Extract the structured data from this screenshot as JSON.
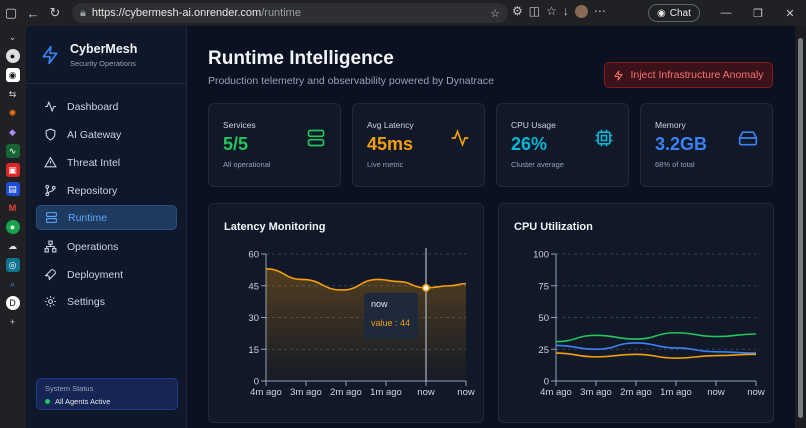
{
  "browser": {
    "url_host": "https://cybermesh-ai.onrender.com",
    "url_path": "/runtime",
    "chat_label": "Chat"
  },
  "sidebar": {
    "brand_name": "CyberMesh",
    "brand_sub": "Security Operations",
    "items": [
      {
        "label": "Dashboard",
        "icon": "activity-icon"
      },
      {
        "label": "AI Gateway",
        "icon": "shield-icon"
      },
      {
        "label": "Threat Intel",
        "icon": "alert-triangle-icon"
      },
      {
        "label": "Repository",
        "icon": "git-branch-icon"
      },
      {
        "label": "Runtime",
        "icon": "server-icon"
      },
      {
        "label": "Operations",
        "icon": "network-icon"
      },
      {
        "label": "Deployment",
        "icon": "rocket-icon"
      },
      {
        "label": "Settings",
        "icon": "gear-icon"
      }
    ],
    "active": "Runtime",
    "status_title": "System Status",
    "status_value": "All Agents Active"
  },
  "header": {
    "title": "Runtime Intelligence",
    "subtitle": "Production telemetry and observability powered by Dynatrace",
    "anomaly_button": "Inject Infrastructure Anomaly"
  },
  "stats": [
    {
      "label": "Services",
      "value": "5/5",
      "sub": "All operational",
      "color": "#22c55e"
    },
    {
      "label": "Avg Latency",
      "value": "45ms",
      "sub": "Live metric",
      "color": "#f59e0b"
    },
    {
      "label": "CPU Usage",
      "value": "26%",
      "sub": "Cluster average",
      "color": "#06b6d4"
    },
    {
      "label": "Memory",
      "value": "3.2GB",
      "sub": "68% of total",
      "color": "#3b82f6"
    }
  ],
  "latency_chart": {
    "title": "Latency Monitoring",
    "tooltip_label": "now",
    "tooltip_value": "value : 44"
  },
  "cpu_chart": {
    "title": "CPU Utilization"
  },
  "chart_data": [
    {
      "type": "area",
      "title": "Latency Monitoring",
      "categories": [
        "4m ago",
        "3m ago",
        "2m ago",
        "1m ago",
        "now",
        "now"
      ],
      "x_positions": [
        0,
        1,
        2,
        3,
        4,
        5
      ],
      "y_ticks": [
        0,
        15,
        30,
        45,
        60
      ],
      "ylim": [
        0,
        60
      ],
      "series": [
        {
          "values_x": [
            0,
            0.9,
            1.9,
            2.8,
            3.3,
            4.0,
            4.6,
            5.0
          ],
          "values": [
            53,
            48,
            43,
            48,
            47,
            44,
            45,
            46
          ],
          "color": "#f59e0b"
        }
      ],
      "highlight": {
        "x": 4,
        "value": 44
      }
    },
    {
      "type": "line",
      "title": "CPU Utilization",
      "categories": [
        "4m ago",
        "3m ago",
        "2m ago",
        "1m ago",
        "now",
        "now"
      ],
      "y_ticks": [
        0,
        25,
        50,
        75,
        100
      ],
      "ylim": [
        0,
        100
      ],
      "series": [
        {
          "values_x": [
            0,
            1,
            2,
            3,
            4,
            5
          ],
          "values": [
            31,
            36,
            33,
            38,
            35,
            37
          ],
          "color": "#22c55e"
        },
        {
          "values_x": [
            0,
            1,
            2,
            3,
            4,
            5
          ],
          "values": [
            28,
            25,
            30,
            26,
            23,
            22
          ],
          "color": "#3b82f6"
        },
        {
          "values_x": [
            0,
            1,
            2,
            3,
            4,
            5
          ],
          "values": [
            22,
            19,
            21,
            18,
            20,
            21
          ],
          "color": "#f59e0b"
        }
      ]
    }
  ]
}
